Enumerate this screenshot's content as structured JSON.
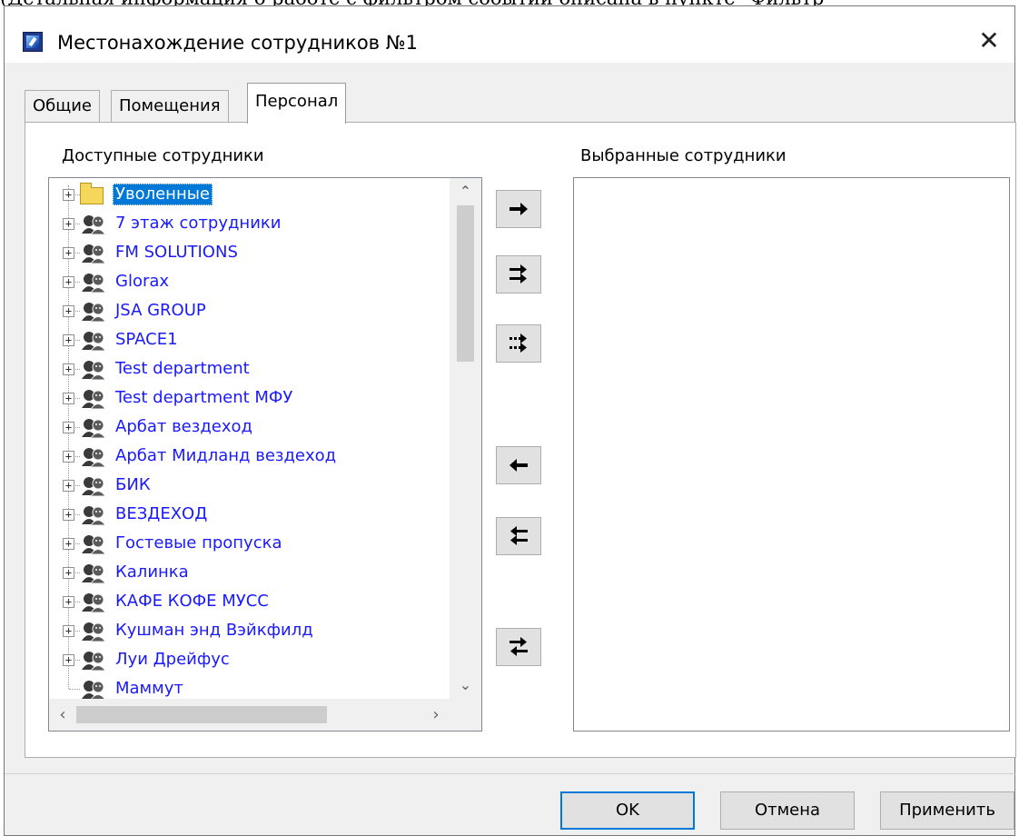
{
  "background_text": "(Детальная информация о работе с фильтром событий описана в пункте \"Фильтр",
  "window": {
    "title": "Местонахождение сотрудников №1",
    "close_glyph": "✕"
  },
  "tabs": [
    {
      "label": "Общие",
      "active": false
    },
    {
      "label": "Помещения",
      "active": false
    },
    {
      "label": "Персонал",
      "active": true
    }
  ],
  "available": {
    "label": "Доступные сотрудники",
    "items": [
      {
        "label": "Уволенные",
        "icon": "folder-icon",
        "selected": true,
        "expandable": true
      },
      {
        "label": "7 этаж сотрудники",
        "icon": "people-group-icon",
        "expandable": true
      },
      {
        "label": "FM SOLUTIONS",
        "icon": "people-group-icon",
        "expandable": true
      },
      {
        "label": "Glorax",
        "icon": "people-group-icon",
        "expandable": true
      },
      {
        "label": "JSA GROUP",
        "icon": "people-group-icon",
        "expandable": true
      },
      {
        "label": "SPACE1",
        "icon": "people-group-icon",
        "expandable": true
      },
      {
        "label": "Test department",
        "icon": "people-group-icon",
        "expandable": true
      },
      {
        "label": "Test department МФУ",
        "icon": "people-group-icon",
        "expandable": true
      },
      {
        "label": "Арбат вездеход",
        "icon": "people-group-icon",
        "expandable": true
      },
      {
        "label": "Арбат Мидланд вездеход",
        "icon": "people-group-icon",
        "expandable": true
      },
      {
        "label": "БИК",
        "icon": "people-group-icon",
        "expandable": true
      },
      {
        "label": "ВЕЗДЕХОД",
        "icon": "people-group-icon",
        "expandable": true
      },
      {
        "label": "Гостевые пропуска",
        "icon": "people-group-icon",
        "expandable": true
      },
      {
        "label": "Калинка",
        "icon": "people-group-icon",
        "expandable": true
      },
      {
        "label": "КАФЕ КОФЕ МУСС",
        "icon": "people-group-icon",
        "expandable": true
      },
      {
        "label": "Кушман энд Вэйкфилд",
        "icon": "people-group-icon",
        "expandable": true
      },
      {
        "label": "Луи Дрейфус",
        "icon": "people-group-icon",
        "expandable": true
      },
      {
        "label": "Маммут",
        "icon": "people-group-icon",
        "expandable": false
      }
    ]
  },
  "selected": {
    "label": "Выбранные сотрудники",
    "items": []
  },
  "transfer_buttons": [
    {
      "name": "add-selected-button",
      "icon": "arrow-right-icon"
    },
    {
      "name": "add-all-button",
      "icon": "double-arrow-right-icon"
    },
    {
      "name": "add-filtered-button",
      "icon": "dotted-double-arrow-right-icon"
    },
    {
      "name": "remove-selected-button",
      "icon": "arrow-left-icon"
    },
    {
      "name": "remove-all-button",
      "icon": "double-arrow-left-icon"
    },
    {
      "name": "swap-button",
      "icon": "swap-arrows-icon"
    }
  ],
  "footer": {
    "ok": "OK",
    "cancel": "Отмена",
    "apply": "Применить"
  },
  "colors": {
    "item_text": "#1a1aff",
    "selection": "#0078d7",
    "default_button_border": "#0078d7"
  }
}
